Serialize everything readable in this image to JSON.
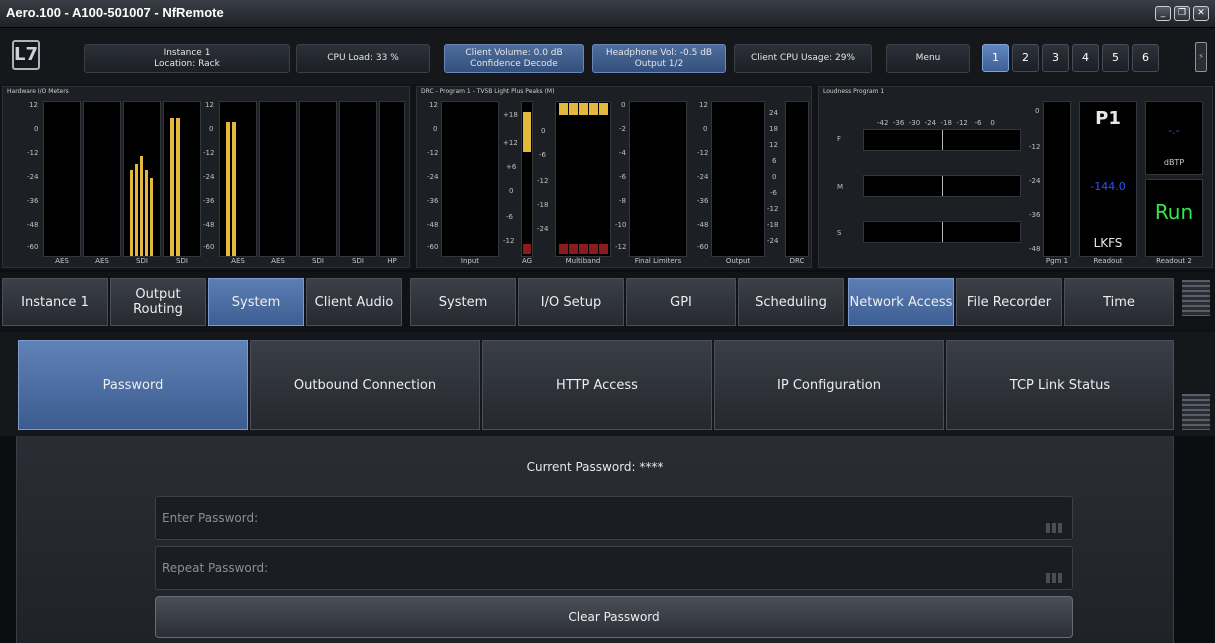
{
  "window": {
    "title": "Aero.100 - A100-501007 - NfRemote",
    "buttons": [
      "_",
      "❐",
      "✕"
    ]
  },
  "header": {
    "logo": "L7",
    "instance": "Instance 1",
    "location": "Location: Rack",
    "cpu_load": "CPU Load: 33 %",
    "client_volume": "Client Volume: 0.0 dB",
    "confidence": "Confidence Decode",
    "headphone_vol": "Headphone Vol: -0.5 dB",
    "headphone_output": "Output 1/2",
    "client_cpu": "Client CPU Usage: 29%",
    "menu": "Menu",
    "instance_buttons": [
      "1",
      "2",
      "3",
      "4",
      "5",
      "6"
    ],
    "active_instance": "1"
  },
  "meters": {
    "hw_title": "Hardware I/O Meters",
    "hw_ticks": [
      "12",
      "0",
      "-12",
      "-24",
      "-36",
      "-48",
      "-60"
    ],
    "hw_labels_left": [
      "AES",
      "AES",
      "SDI",
      "SDI"
    ],
    "hw_labels_right": [
      "AES",
      "AES",
      "SDI",
      "SDI",
      "HP"
    ],
    "drc_title": "DRC - Program 1 - TV5B Light Plus Peaks (M)",
    "drc_ticks": [
      "12",
      "0",
      "-12",
      "-24",
      "-36",
      "-48",
      "-60"
    ],
    "ag_ticks": [
      "+18",
      "+12",
      "+6",
      "0",
      "-6",
      "-12"
    ],
    "ag_ticks2": [
      "0",
      "-6",
      "-12",
      "-18",
      "-24"
    ],
    "mb_ticks": [
      "0",
      "-2",
      "-4",
      "-6",
      "-8",
      "-10",
      "-12"
    ],
    "drc_ticks2": [
      "24",
      "18",
      "12",
      "6",
      "0",
      "-6",
      "-12",
      "-18",
      "-24"
    ],
    "drc_labels": [
      "Input",
      "AG",
      "Multiband",
      "Final Limiters",
      "Output",
      "DRC"
    ],
    "loud_title": "Loudness Program 1",
    "loud_scale": "-42  -36  -30  -24  -18  -12   -6    0",
    "loud_rows": [
      "F",
      "M",
      "S"
    ],
    "pgm_ticks": [
      "0",
      "-12",
      "-24",
      "-36",
      "-48"
    ],
    "pgm_label": "Pgm 1",
    "p1": "P1",
    "lkfs_value": "-144.0",
    "lkfs": "LKFS",
    "readout": "Readout",
    "dbtp_value": "-.-",
    "dbtp": "dBTP",
    "run": "Run",
    "readout2": "Readout 2"
  },
  "tabs_left": [
    {
      "label": "Instance 1"
    },
    {
      "label": "Output Routing"
    },
    {
      "label": "System"
    },
    {
      "label": "Client Audio"
    }
  ],
  "tabs_right": [
    {
      "label": "System"
    },
    {
      "label": "I/O Setup"
    },
    {
      "label": "GPI"
    },
    {
      "label": "Scheduling"
    },
    {
      "label": "Network Access"
    },
    {
      "label": "File Recorder"
    },
    {
      "label": "Time"
    }
  ],
  "subtabs": [
    "Password",
    "Outbound Connection",
    "HTTP Access",
    "IP Configuration",
    "TCP Link Status"
  ],
  "password": {
    "current": "Current Password: ****",
    "enter_placeholder": "Enter Password:",
    "repeat_placeholder": "Repeat Password:",
    "clear": "Clear Password"
  },
  "colors": {
    "accent": "#4f72a8",
    "meter_fill": "#e2b93b",
    "run_green": "#32e84a",
    "lkfs_blue": "#3050ff"
  }
}
